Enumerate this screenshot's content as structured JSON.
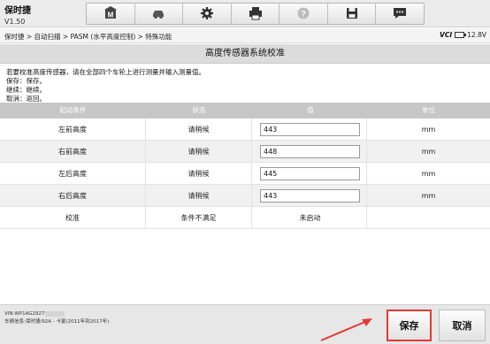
{
  "app": {
    "title": "保时捷",
    "version": "V1.50"
  },
  "toolbar": {
    "buttons": [
      {
        "icon": "home-icon"
      },
      {
        "icon": "car-icon"
      },
      {
        "icon": "gear-icon"
      },
      {
        "icon": "printer-icon"
      },
      {
        "icon": "help-icon"
      },
      {
        "icon": "save-icon"
      },
      {
        "icon": "message-icon"
      }
    ]
  },
  "breadcrumb": "保时捷 > 自动扫描 > PASM (水平高度控制) > 特殊功能",
  "status": {
    "vci_label": "VCI",
    "voltage": "12.8V"
  },
  "page_title": "高度传感器系统校准",
  "instructions": {
    "line1": "若要校准高度传感器，请在全部四个车轮上进行测量并输入测量值。",
    "line2": "保存：保存。",
    "line3": "继续：继续。",
    "line4": "取消：返回。"
  },
  "table": {
    "headers": {
      "c1": "起动条件",
      "c2": "状态",
      "c3": "值",
      "c4": "单位"
    },
    "rows": [
      {
        "name": "左前高度",
        "status": "请稍候",
        "value": "443",
        "unit": "mm"
      },
      {
        "name": "右前高度",
        "status": "请稍候",
        "value": "448",
        "unit": "mm"
      },
      {
        "name": "左后高度",
        "status": "请稍候",
        "value": "445",
        "unit": "mm"
      },
      {
        "name": "右后高度",
        "status": "请稍候",
        "value": "443",
        "unit": "mm"
      },
      {
        "name": "校准",
        "status": "条件不满足",
        "value": "未启动",
        "unit": ""
      }
    ]
  },
  "footer": {
    "vin": "VIN:WP1AG2927",
    "vehicle_info": "车辆信息:保时捷/92A - 卡宴(2011年到2017年)",
    "save_label": "保存",
    "cancel_label": "取消"
  },
  "colors": {
    "highlight": "#e53935",
    "header_bg": "#c7c7c7"
  }
}
